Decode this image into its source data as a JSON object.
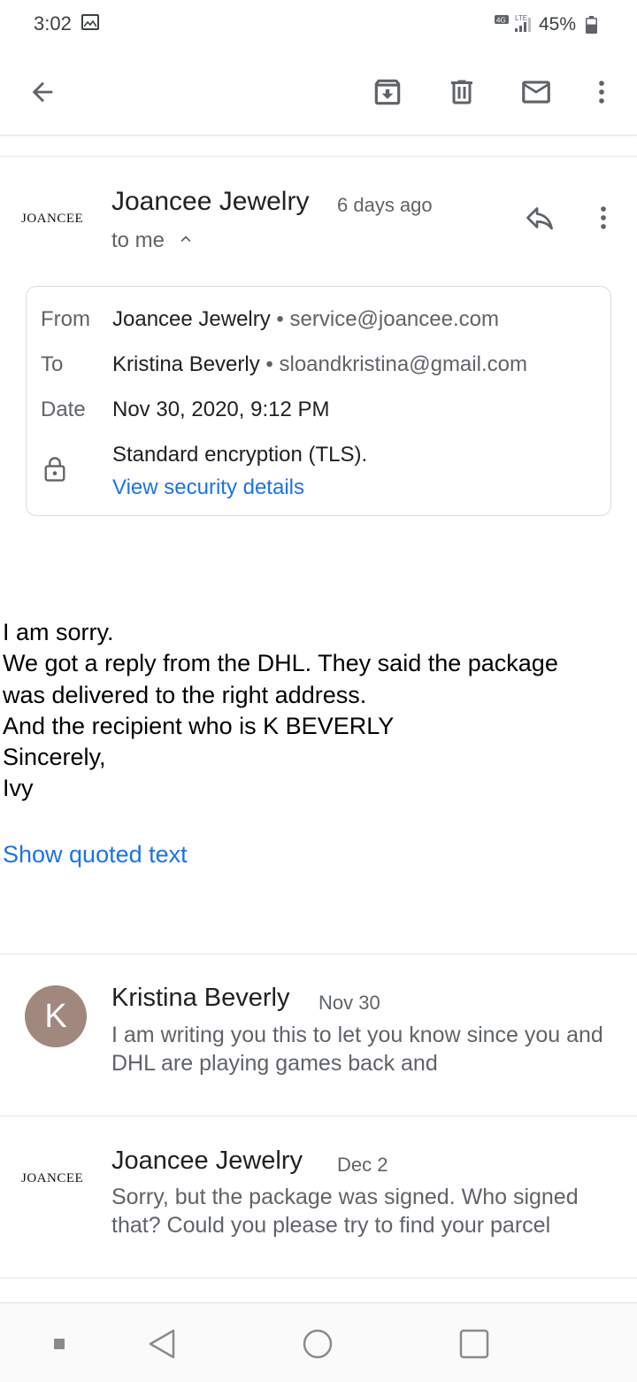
{
  "status_bar": {
    "time": "3:02",
    "battery": "45%"
  },
  "toolbar": {
    "back_icon": "arrow-left-icon",
    "archive_icon": "archive-icon",
    "delete_icon": "trash-icon",
    "mark_unread_icon": "mail-icon",
    "more_icon": "more-vert-icon"
  },
  "message": {
    "logo_text": "JOANCEE",
    "sender": "Joancee Jewelry",
    "time_ago": "6 days ago",
    "recipient_summary": "to me",
    "details": {
      "from_label": "From",
      "from_name": "Joancee Jewelry",
      "from_email": "service@joancee.com",
      "to_label": "To",
      "to_name": "Kristina Beverly",
      "to_email": "sloandkristina@gmail.com",
      "date_label": "Date",
      "date_value": "Nov 30, 2020, 9:12 PM",
      "encryption": "Standard encryption (TLS).",
      "security_link": "View security details"
    },
    "body_lines": [
      "I am sorry.",
      "We got a reply from the DHL. They said the package",
      "was delivered to the right address.",
      "And the recipient who is K BEVERLY",
      "Sincerely,",
      "Ivy"
    ],
    "show_quoted": "Show quoted text"
  },
  "thread": [
    {
      "avatar_letter": "K",
      "sender": "Kristina Beverly",
      "date": "Nov 30",
      "snippet": "I am writing you this to let you know since you and DHL are playing games back and"
    },
    {
      "logo_text": "JOANCEE",
      "sender": "Joancee Jewelry",
      "date": "Dec 2",
      "snippet": "Sorry, but the package was signed. Who signed that? Could you please try to find your parcel"
    }
  ],
  "colors": {
    "link": "#1a73e8",
    "avatar": "#a1887f"
  }
}
